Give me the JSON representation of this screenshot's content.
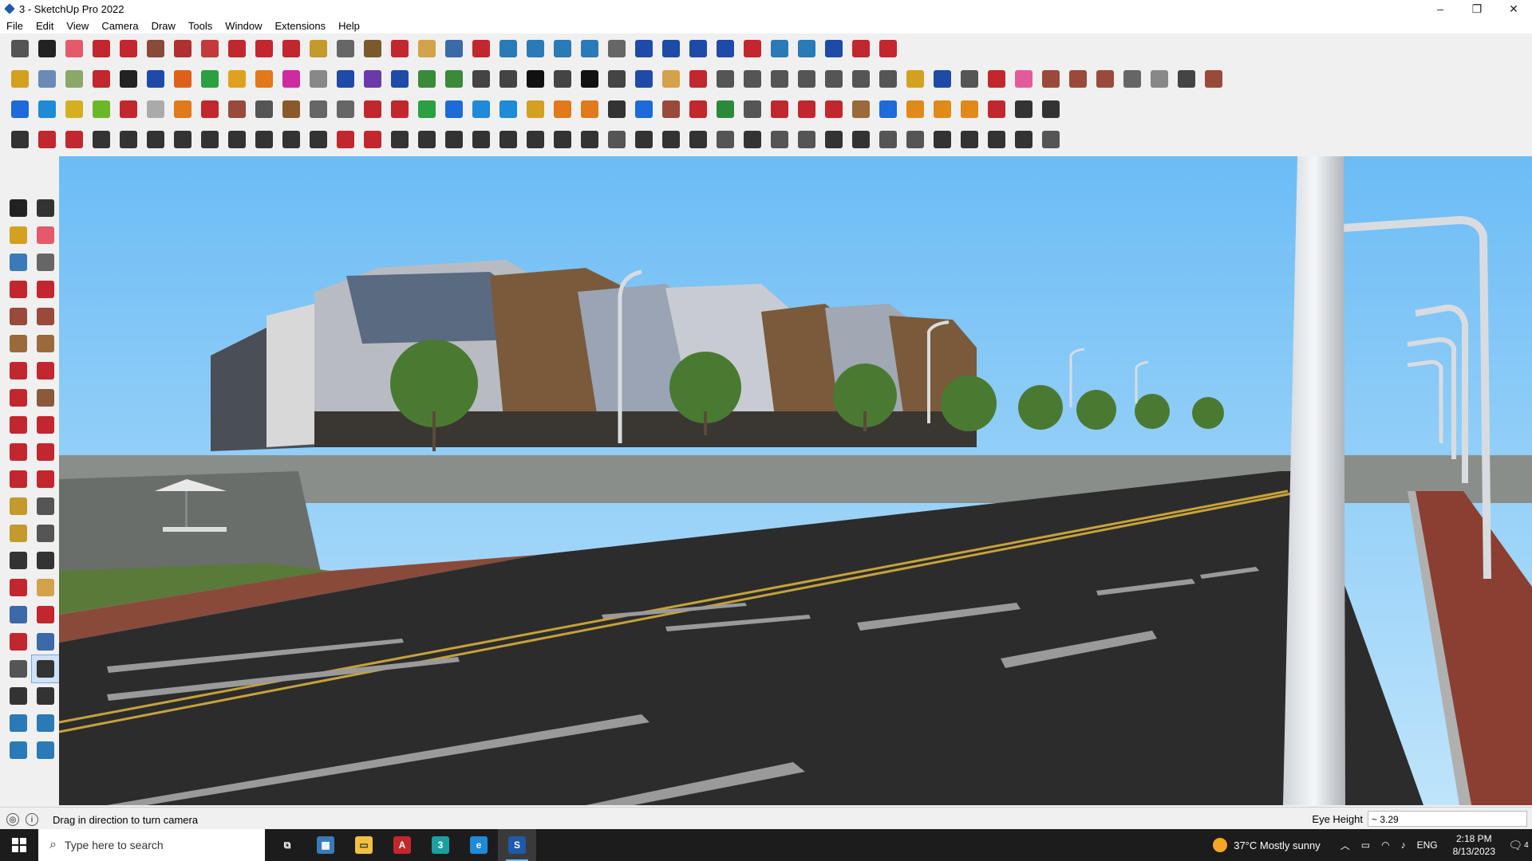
{
  "window": {
    "title": "3 - SketchUp Pro 2022",
    "controls": {
      "minimize": "–",
      "maximize": "❐",
      "close": "✕"
    }
  },
  "menu": [
    "File",
    "Edit",
    "View",
    "Camera",
    "Draw",
    "Tools",
    "Window",
    "Extensions",
    "Help"
  ],
  "toolbar_row1": [
    {
      "icon": "zoom-extents-icon",
      "color": "#555555"
    },
    {
      "icon": "select-icon",
      "color": "#222222"
    },
    {
      "icon": "eraser-icon",
      "color": "#e35b6b"
    },
    {
      "icon": "line-icon",
      "color": "#c2272d"
    },
    {
      "icon": "arc-icon",
      "color": "#c2272d"
    },
    {
      "icon": "rectangle-icon",
      "color": "#8a4a3a"
    },
    {
      "icon": "push-pull-icon",
      "color": "#b03030"
    },
    {
      "icon": "follow-me-icon",
      "color": "#c23a3a"
    },
    {
      "icon": "move-icon",
      "color": "#c2272d"
    },
    {
      "icon": "rotate-icon",
      "color": "#c2272d"
    },
    {
      "icon": "scale-icon",
      "color": "#c2272d"
    },
    {
      "icon": "tape-measure-icon",
      "color": "#c49a2d"
    },
    {
      "icon": "text-icon",
      "color": "#666666"
    },
    {
      "icon": "paint-bucket-icon",
      "color": "#7a5a2a"
    },
    {
      "icon": "orbit-icon",
      "color": "#c2272d"
    },
    {
      "icon": "pan-icon",
      "color": "#d4a24a"
    },
    {
      "icon": "zoom-icon",
      "color": "#3a6aa8"
    },
    {
      "icon": "zoom-window-icon",
      "color": "#c2272d"
    },
    {
      "icon": "section-plane-icon",
      "color": "#2a7ab8"
    },
    {
      "icon": "sandbox-icon",
      "color": "#2a7ab8"
    },
    {
      "icon": "layers-icon",
      "color": "#2a7ab8"
    },
    {
      "icon": "styles-icon",
      "color": "#2a7ab8"
    },
    {
      "icon": "account-icon",
      "color": "#666666"
    },
    {
      "icon": "component-icon",
      "color": "#1e4aa8"
    },
    {
      "icon": "solid-tools-icon",
      "color": "#1e4aa8"
    },
    {
      "icon": "dimension-icon",
      "color": "#1e4aa8"
    },
    {
      "icon": "arrow-up-down-icon",
      "color": "#1e4aa8"
    },
    {
      "icon": "arrow-swap-icon",
      "color": "#c2272d"
    },
    {
      "icon": "axes-icon",
      "color": "#2a7ab8"
    },
    {
      "icon": "extension-warehouse-icon",
      "color": "#2a7ab8"
    },
    {
      "icon": "undo-icon",
      "color": "#1e4aa8"
    },
    {
      "icon": "redo-icon",
      "color": "#c2272d"
    },
    {
      "icon": "layout-icon",
      "color": "#c2272d"
    }
  ],
  "toolbar_row2": [
    {
      "icon": "box-iso-icon",
      "color": "#d4a020"
    },
    {
      "icon": "box-xray-icon",
      "color": "#6a8ab8"
    },
    {
      "icon": "box-textured-icon",
      "color": "#8aa868"
    },
    {
      "icon": "push-red-icon",
      "color": "#c2272d"
    },
    {
      "icon": "push-black-icon",
      "color": "#222222"
    },
    {
      "icon": "push-blue-icon",
      "color": "#1e4aa8"
    },
    {
      "icon": "push-orange-icon",
      "color": "#e0601a"
    },
    {
      "icon": "push-green-icon",
      "color": "#2aa040"
    },
    {
      "icon": "push-yellow-icon",
      "color": "#e0a020"
    },
    {
      "icon": "push-orange2-icon",
      "color": "#e07a1a"
    },
    {
      "icon": "push-pink-icon",
      "color": "#d02aa0"
    },
    {
      "icon": "curve-icon",
      "color": "#888888"
    },
    {
      "icon": "slash-blue-icon",
      "color": "#1e4aa8"
    },
    {
      "icon": "slash-purple-icon",
      "color": "#6a3aa8"
    },
    {
      "icon": "slash-blue2-icon",
      "color": "#1e4aa8"
    },
    {
      "icon": "tile-green-icon",
      "color": "#3a8a3a"
    },
    {
      "icon": "tile-green2-icon",
      "color": "#3a8a3a"
    },
    {
      "icon": "house-iso-icon",
      "color": "#444444"
    },
    {
      "icon": "house-front-icon",
      "color": "#444444"
    },
    {
      "icon": "house-icon",
      "color": "#111111"
    },
    {
      "icon": "house-back-icon",
      "color": "#444444"
    },
    {
      "icon": "house-outline-icon",
      "color": "#111111"
    },
    {
      "icon": "house-bottom-icon",
      "color": "#444444"
    },
    {
      "icon": "font-icon",
      "color": "#1e4aa8"
    },
    {
      "icon": "leaf-icon",
      "color": "#d4a24a"
    },
    {
      "icon": "pencil-red-icon",
      "color": "#c2272d"
    },
    {
      "icon": "shape-rect-icon",
      "color": "#555555"
    },
    {
      "icon": "shape-circle-icon",
      "color": "#555555"
    },
    {
      "icon": "shape-hex-icon",
      "color": "#555555"
    },
    {
      "icon": "shape-ellipse-icon",
      "color": "#555555"
    },
    {
      "icon": "shape-parallel-icon",
      "color": "#555555"
    },
    {
      "icon": "shape-arc-icon",
      "color": "#555555"
    },
    {
      "icon": "shape-bezier-icon",
      "color": "#555555"
    },
    {
      "icon": "freehand-icon",
      "color": "#d4a020"
    },
    {
      "icon": "select-blue-icon",
      "color": "#1e4aa8"
    },
    {
      "icon": "transform-icon",
      "color": "#555555"
    },
    {
      "icon": "measure-red-icon",
      "color": "#c2272d"
    },
    {
      "icon": "eraser-pink-icon",
      "color": "#e35b9b"
    },
    {
      "icon": "brown-tile-icon",
      "color": "#9a4a3a"
    },
    {
      "icon": "grid-tile-icon",
      "color": "#9a4a3a"
    },
    {
      "icon": "roof-icon",
      "color": "#9a4a3a"
    },
    {
      "icon": "roof2-icon",
      "color": "#666666"
    },
    {
      "icon": "roof3-icon",
      "color": "#888888"
    },
    {
      "icon": "roof4-icon",
      "color": "#444444"
    },
    {
      "icon": "roof5-icon",
      "color": "#9a4a3a"
    }
  ],
  "toolbar_row3": [
    {
      "icon": "plane-blue-icon",
      "color": "#1e6ad8"
    },
    {
      "icon": "plane-blue2-icon",
      "color": "#1e8ad8"
    },
    {
      "icon": "plane-yellow-icon",
      "color": "#d4b020"
    },
    {
      "icon": "plane-green-icon",
      "color": "#6ab828"
    },
    {
      "icon": "plane-red-icon",
      "color": "#c2272d"
    },
    {
      "icon": "plane-grey-icon",
      "color": "#aaaaaa"
    },
    {
      "icon": "loop-icon",
      "color": "#e07a1a"
    },
    {
      "icon": "offset-red-icon",
      "color": "#c2272d"
    },
    {
      "icon": "stairs-icon",
      "color": "#9a4a3a"
    },
    {
      "icon": "flag-icon",
      "color": "#555555"
    },
    {
      "icon": "extrude-icon",
      "color": "#8a5a2a"
    },
    {
      "icon": "chain-icon",
      "color": "#666666"
    },
    {
      "icon": "fillet-icon",
      "color": "#666666"
    },
    {
      "icon": "curve-red-icon",
      "color": "#c2272d"
    },
    {
      "icon": "cross-red-icon",
      "color": "#c2272d"
    },
    {
      "icon": "cross-green-icon",
      "color": "#2aa040"
    },
    {
      "icon": "cross-blue-icon",
      "color": "#1e6ad8"
    },
    {
      "icon": "cone-icon",
      "color": "#1e8ad8"
    },
    {
      "icon": "cone-split-icon",
      "color": "#1e8ad8"
    },
    {
      "icon": "triangle-icon",
      "color": "#d4a020"
    },
    {
      "icon": "lasso-icon",
      "color": "#e07a1a"
    },
    {
      "icon": "lasso-x-icon",
      "color": "#e07a1a"
    },
    {
      "icon": "rotate-dark-icon",
      "color": "#333333"
    },
    {
      "icon": "axes-blue-icon",
      "color": "#1e6ad8"
    },
    {
      "icon": "bucket-icon",
      "color": "#9a4a3a"
    },
    {
      "icon": "undo-red-icon",
      "color": "#c2272d"
    },
    {
      "icon": "tree-icon",
      "color": "#2a8a3a"
    },
    {
      "icon": "copy-array-icon",
      "color": "#555555"
    },
    {
      "icon": "copy-red-icon",
      "color": "#c2272d"
    },
    {
      "icon": "copy-red2-icon",
      "color": "#c2272d"
    },
    {
      "icon": "stamp-icon",
      "color": "#c2272d"
    },
    {
      "icon": "gear-group-icon",
      "color": "#9a6a3a"
    },
    {
      "icon": "frame-icon",
      "color": "#1e6ad8"
    },
    {
      "icon": "grid-orange-icon",
      "color": "#e08a1a"
    },
    {
      "icon": "grid-orange2-icon",
      "color": "#e08a1a"
    },
    {
      "icon": "grid-orange3-icon",
      "color": "#e08a1a"
    },
    {
      "icon": "explode-icon",
      "color": "#c2272d"
    },
    {
      "icon": "dotted-arc-icon",
      "color": "#333333"
    },
    {
      "icon": "qr-grid-icon",
      "color": "#333333"
    }
  ],
  "toolbar_row4": [
    {
      "icon": "draw-poly-icon",
      "color": "#333333"
    },
    {
      "icon": "bezier-red-icon",
      "color": "#c2272d"
    },
    {
      "icon": "sweep-icon",
      "color": "#c2272d"
    },
    {
      "icon": "scissors-icon",
      "color": "#333333"
    },
    {
      "icon": "gear-outline-icon",
      "color": "#333333"
    },
    {
      "icon": "morph-icon",
      "color": "#333333"
    },
    {
      "icon": "spring-icon",
      "color": "#333333"
    },
    {
      "icon": "shell-icon",
      "color": "#333333"
    },
    {
      "icon": "sphere-icon",
      "color": "#333333"
    },
    {
      "icon": "bend-icon",
      "color": "#333333"
    },
    {
      "icon": "corner-icon",
      "color": "#333333"
    },
    {
      "icon": "corner2-icon",
      "color": "#333333"
    },
    {
      "icon": "knife-red-icon",
      "color": "#c2272d"
    },
    {
      "icon": "curl-icon",
      "color": "#c2272d"
    },
    {
      "icon": "cage-icon",
      "color": "#333333"
    },
    {
      "icon": "cone-outline-icon",
      "color": "#333333"
    },
    {
      "icon": "fence-icon",
      "color": "#333333"
    },
    {
      "icon": "spiral-icon",
      "color": "#333333"
    },
    {
      "icon": "hand-icon",
      "color": "#333333"
    },
    {
      "icon": "leaf-outline-icon",
      "color": "#333333"
    },
    {
      "icon": "fan-icon",
      "color": "#333333"
    },
    {
      "icon": "stack-icon",
      "color": "#333333"
    },
    {
      "icon": "slant-icon",
      "color": "#555555"
    },
    {
      "icon": "wing-icon",
      "color": "#333333"
    },
    {
      "icon": "wing2-icon",
      "color": "#333333"
    },
    {
      "icon": "wing3-icon",
      "color": "#333333"
    },
    {
      "icon": "bridge-icon",
      "color": "#555555"
    },
    {
      "icon": "stripe-icon",
      "color": "#333333"
    },
    {
      "icon": "panel-icon",
      "color": "#555555"
    },
    {
      "icon": "panel2-icon",
      "color": "#555555"
    },
    {
      "icon": "stripe2-icon",
      "color": "#333333"
    },
    {
      "icon": "hatch-icon",
      "color": "#333333"
    },
    {
      "icon": "hatch2-icon",
      "color": "#555555"
    },
    {
      "icon": "comb-icon",
      "color": "#555555"
    },
    {
      "icon": "globe-icon",
      "color": "#333333"
    },
    {
      "icon": "globe2-icon",
      "color": "#333333"
    },
    {
      "icon": "stripe3-icon",
      "color": "#333333"
    },
    {
      "icon": "comb2-icon",
      "color": "#333333"
    },
    {
      "icon": "cube-outline-icon",
      "color": "#555555"
    }
  ],
  "left_toolbar": [
    {
      "icon": "select-arrow-icon",
      "color": "#222222"
    },
    {
      "icon": "orbit-dark-icon",
      "color": "#333333"
    },
    {
      "icon": "paint-bucket-icon",
      "color": "#d4a020"
    },
    {
      "icon": "eraser-icon",
      "color": "#e35b6b"
    },
    {
      "icon": "component-maker-icon",
      "color": "#3a7ab8"
    },
    {
      "icon": "tag-icon",
      "color": "#666666"
    },
    {
      "icon": "line-pencil-icon",
      "color": "#c2272d"
    },
    {
      "icon": "freehand-icon",
      "color": "#c2272d"
    },
    {
      "icon": "rectangle-icon",
      "color": "#9a4a3a"
    },
    {
      "icon": "rotated-rect-icon",
      "color": "#9a4a3a"
    },
    {
      "icon": "circle-icon",
      "color": "#9a6a3a"
    },
    {
      "icon": "polygon-icon",
      "color": "#9a6a3a"
    },
    {
      "icon": "arc-icon",
      "color": "#c2272d"
    },
    {
      "icon": "arc-2pt-icon",
      "color": "#c2272d"
    },
    {
      "icon": "arc-3pt-icon",
      "color": "#c2272d"
    },
    {
      "icon": "pie-icon",
      "color": "#8a5a3a"
    },
    {
      "icon": "move-icon",
      "color": "#c2272d"
    },
    {
      "icon": "push-pull-icon",
      "color": "#c2272d"
    },
    {
      "icon": "rotate-icon",
      "color": "#c2272d"
    },
    {
      "icon": "follow-me-icon",
      "color": "#c2272d"
    },
    {
      "icon": "scale-icon",
      "color": "#c2272d"
    },
    {
      "icon": "offset-icon",
      "color": "#c2272d"
    },
    {
      "icon": "tape-measure-icon",
      "color": "#c49a2d"
    },
    {
      "icon": "dimension-icon",
      "color": "#555555"
    },
    {
      "icon": "protractor-icon",
      "color": "#c49a2d"
    },
    {
      "icon": "text-icon",
      "color": "#555555"
    },
    {
      "icon": "axes-icon",
      "color": "#333333"
    },
    {
      "icon": "3d-text-icon",
      "color": "#333333"
    },
    {
      "icon": "orbit-icon",
      "color": "#c2272d"
    },
    {
      "icon": "pan-icon",
      "color": "#d4a24a"
    },
    {
      "icon": "zoom-icon",
      "color": "#3a6aa8"
    },
    {
      "icon": "zoom-window-icon",
      "color": "#c2272d"
    },
    {
      "icon": "zoom-extents-icon",
      "color": "#c2272d"
    },
    {
      "icon": "previous-view-icon",
      "color": "#3a6aa8"
    },
    {
      "icon": "position-camera-icon",
      "color": "#555555"
    },
    {
      "icon": "look-around-icon",
      "color": "#333333"
    },
    {
      "icon": "walk-icon",
      "color": "#333333"
    },
    {
      "icon": "section-plane-icon",
      "color": "#333333"
    },
    {
      "icon": "display-section-icon",
      "color": "#2a7ab8"
    },
    {
      "icon": "section-cuts-icon",
      "color": "#2a7ab8"
    },
    {
      "icon": "section-fill-icon",
      "color": "#2a7ab8"
    },
    {
      "icon": "sandbox-icon",
      "color": "#2a7ab8"
    }
  ],
  "active_left_tool": "look-around-icon",
  "status": {
    "hint": "Drag in direction to turn camera",
    "eye_height_label": "Eye Height",
    "eye_height_value": "~ 3.29"
  },
  "taskbar": {
    "search_placeholder": "Type here to search",
    "apps": [
      {
        "icon": "task-view-icon",
        "color": "#ffffff",
        "glyph": "⧉"
      },
      {
        "icon": "calculator-icon",
        "color": "#3a7ab8",
        "glyph": "▦"
      },
      {
        "icon": "file-explorer-icon",
        "color": "#f0c040",
        "glyph": "▭"
      },
      {
        "icon": "acrobat-icon",
        "color": "#c2272d",
        "glyph": "A"
      },
      {
        "icon": "3ds-max-icon",
        "color": "#1aa0a0",
        "glyph": "3"
      },
      {
        "icon": "edge-icon",
        "color": "#1e8ad8",
        "glyph": "e"
      },
      {
        "icon": "sketchup-icon",
        "color": "#1e5aa8",
        "glyph": "S"
      }
    ],
    "weather": "37°C  Mostly sunny",
    "language": "ENG",
    "time": "2:18 PM",
    "date": "8/13/2023",
    "notifications": "4"
  }
}
